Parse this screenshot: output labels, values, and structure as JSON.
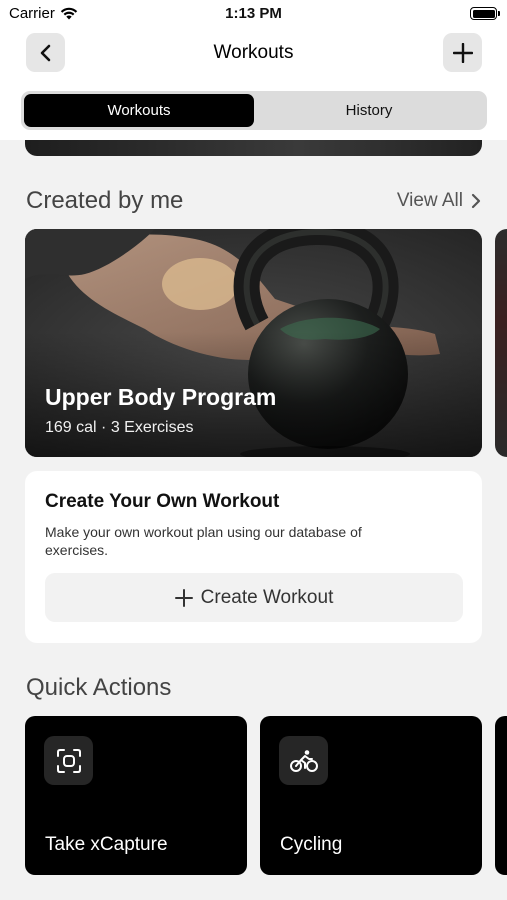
{
  "status_bar": {
    "carrier": "Carrier",
    "time": "1:13 PM"
  },
  "nav": {
    "title": "Workouts",
    "back_icon": "chevron-left-icon",
    "add_icon": "plus-icon"
  },
  "segments": [
    {
      "label": "Workouts",
      "active": true
    },
    {
      "label": "History",
      "active": false
    }
  ],
  "created_by_me": {
    "title": "Created by me",
    "view_all": "View All",
    "card": {
      "title": "Upper Body Program",
      "meta": "169 cal · 3 Exercises"
    }
  },
  "create_workout": {
    "title": "Create Your Own Workout",
    "description": "Make your own workout plan using our database of exercises.",
    "button_label": "Create Workout"
  },
  "quick_actions": {
    "title": "Quick Actions",
    "items": [
      {
        "label": "Take xCapture",
        "icon": "scan-frame-icon"
      },
      {
        "label": "Cycling",
        "icon": "cycling-icon"
      }
    ]
  }
}
